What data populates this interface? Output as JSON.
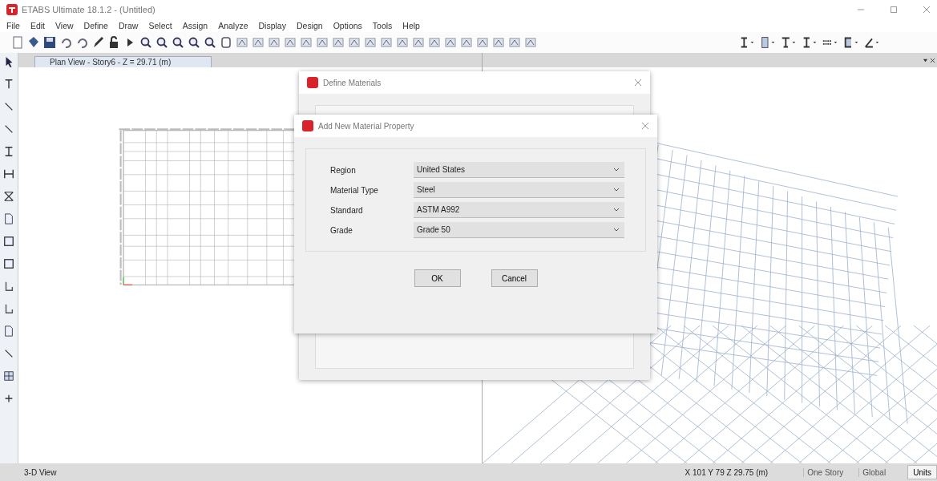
{
  "window": {
    "title": "ETABS Ultimate 18.1.2 - (Untitled)"
  },
  "menu": [
    "File",
    "Edit",
    "View",
    "Define",
    "Draw",
    "Select",
    "Assign",
    "Analyze",
    "Display",
    "Design",
    "Options",
    "Tools",
    "Help"
  ],
  "plan_view": {
    "tab_title": "Plan View - Story6 - Z = 29.71 (m)"
  },
  "define_dialog": {
    "title": "Define Materials"
  },
  "add_dialog": {
    "title": "Add New Material Property",
    "fields": [
      {
        "label": "Region",
        "value": "United States"
      },
      {
        "label": "Material Type",
        "value": "Steel"
      },
      {
        "label": "Standard",
        "value": "ASTM A992"
      },
      {
        "label": "Grade",
        "value": "Grade 50"
      }
    ],
    "buttons": [
      "OK",
      "Cancel"
    ]
  },
  "status_bar": {
    "view": "3-D View",
    "coordinates": "X 101 Y 79 Z 29.75 (m)",
    "story": "One Story",
    "system": "Global",
    "units": "Units"
  }
}
